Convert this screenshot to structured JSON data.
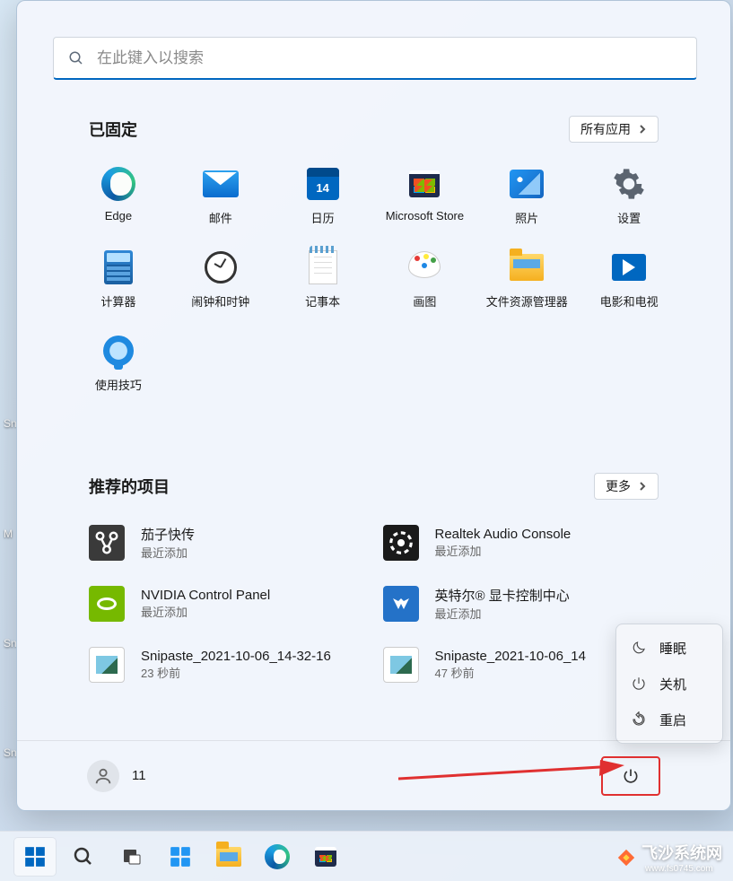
{
  "desktop": {
    "labels": [
      "Sn",
      "M",
      "Sn",
      "Sn"
    ]
  },
  "search": {
    "placeholder": "在此键入以搜索"
  },
  "pinned": {
    "title": "已固定",
    "all_apps_label": "所有应用",
    "items": [
      {
        "label": "Edge",
        "icon": "edge"
      },
      {
        "label": "邮件",
        "icon": "mail"
      },
      {
        "label": "日历",
        "icon": "calendar"
      },
      {
        "label": "Microsoft Store",
        "icon": "store"
      },
      {
        "label": "照片",
        "icon": "photos"
      },
      {
        "label": "设置",
        "icon": "settings"
      },
      {
        "label": "计算器",
        "icon": "calculator"
      },
      {
        "label": "闹钟和时钟",
        "icon": "clock"
      },
      {
        "label": "记事本",
        "icon": "notepad"
      },
      {
        "label": "画图",
        "icon": "paint"
      },
      {
        "label": "文件资源管理器",
        "icon": "explorer"
      },
      {
        "label": "电影和电视",
        "icon": "movies"
      },
      {
        "label": "使用技巧",
        "icon": "tips"
      }
    ]
  },
  "recommended": {
    "title": "推荐的项目",
    "more_label": "更多",
    "items": [
      {
        "name": "茄子快传",
        "sub": "最近添加",
        "icon": "qiezi"
      },
      {
        "name": "Realtek Audio Console",
        "sub": "最近添加",
        "icon": "realtek"
      },
      {
        "name": "NVIDIA Control Panel",
        "sub": "最近添加",
        "icon": "nvidia"
      },
      {
        "name": "英特尔® 显卡控制中心",
        "sub": "最近添加",
        "icon": "intel"
      },
      {
        "name": "Snipaste_2021-10-06_14-32-16",
        "sub": "23 秒前",
        "icon": "image"
      },
      {
        "name": "Snipaste_2021-10-06_14",
        "sub": "47 秒前",
        "icon": "image"
      }
    ]
  },
  "footer": {
    "user_name": "11"
  },
  "power_menu": {
    "sleep": "睡眠",
    "shutdown": "关机",
    "restart": "重启"
  },
  "watermark": {
    "brand": "飞沙系统网",
    "url": "www.fs0745.com"
  }
}
